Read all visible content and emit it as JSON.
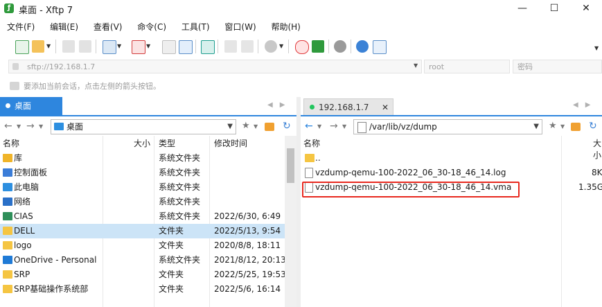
{
  "window": {
    "title": "桌面 - Xftp 7",
    "app_icon_glyph": "ƒ",
    "minimize": "—",
    "maximize": "☐",
    "close": "✕"
  },
  "menu": [
    "文件(F)",
    "编辑(E)",
    "查看(V)",
    "命令(C)",
    "工具(T)",
    "窗口(W)",
    "帮助(H)"
  ],
  "address": {
    "host_placeholder": "sftp://192.168.1.7",
    "user_placeholder": "root",
    "password_placeholder": "密码"
  },
  "hint": "要添加当前会话，点击左侧的箭头按钮。",
  "left_pane": {
    "tab_label": "桌面",
    "path": "桌面",
    "columns": [
      "名称",
      "大小",
      "类型",
      "修改时间"
    ],
    "rows": [
      {
        "name": "库",
        "size": "",
        "type": "系统文件夹",
        "modified": "",
        "icon": "library-icon",
        "color": "#f0b429"
      },
      {
        "name": "控制面板",
        "size": "",
        "type": "系统文件夹",
        "modified": "",
        "icon": "control-panel-icon",
        "color": "#3b7dd8"
      },
      {
        "name": "此电脑",
        "size": "",
        "type": "系统文件夹",
        "modified": "",
        "icon": "computer-icon",
        "color": "#2d8fe0"
      },
      {
        "name": "网络",
        "size": "",
        "type": "系统文件夹",
        "modified": "",
        "icon": "network-icon",
        "color": "#2a70c8"
      },
      {
        "name": "CIAS",
        "size": "",
        "type": "系统文件夹",
        "modified": "2022/6/30, 6:49",
        "icon": "user-folder-icon",
        "color": "#2f8f5a"
      },
      {
        "name": "DELL",
        "size": "",
        "type": "文件夹",
        "modified": "2022/5/13, 9:54",
        "icon": "folder-icon",
        "color": "#f5c542"
      },
      {
        "name": "logo",
        "size": "",
        "type": "文件夹",
        "modified": "2020/8/8, 18:11",
        "icon": "folder-icon",
        "color": "#f5c542"
      },
      {
        "name": "OneDrive - Personal",
        "size": "",
        "type": "系统文件夹",
        "modified": "2021/8/12, 20:13",
        "icon": "onedrive-icon",
        "color": "#1f7ad6"
      },
      {
        "name": "SRP",
        "size": "",
        "type": "文件夹",
        "modified": "2022/5/25, 19:53",
        "icon": "folder-icon",
        "color": "#f5c542"
      },
      {
        "name": "SRP基础操作系统部",
        "size": "",
        "type": "文件夹",
        "modified": "2022/5/6, 16:14",
        "icon": "folder-icon",
        "color": "#f5c542"
      }
    ],
    "selected_index": 5
  },
  "right_pane": {
    "tab_label": "192.168.1.7",
    "tab_close": "✕",
    "path": "/var/lib/vz/dump",
    "columns": [
      "名称",
      "大小"
    ],
    "rows": [
      {
        "name": "..",
        "size": "",
        "icon": "folder-icon",
        "color": "#f5c542"
      },
      {
        "name": "vzdump-qemu-100-2022_06_30-18_46_14.log",
        "size": "8K",
        "icon": "file-icon",
        "color": "#ffffff"
      },
      {
        "name": "vzdump-qemu-100-2022_06_30-18_46_14.vma",
        "size": "1.35G",
        "icon": "file-icon",
        "color": "#ffffff"
      }
    ],
    "highlight_index": 2,
    "highlight_color": "#e8281e"
  },
  "colors": {
    "accent": "#2e86de",
    "connected": "#22c55e"
  }
}
